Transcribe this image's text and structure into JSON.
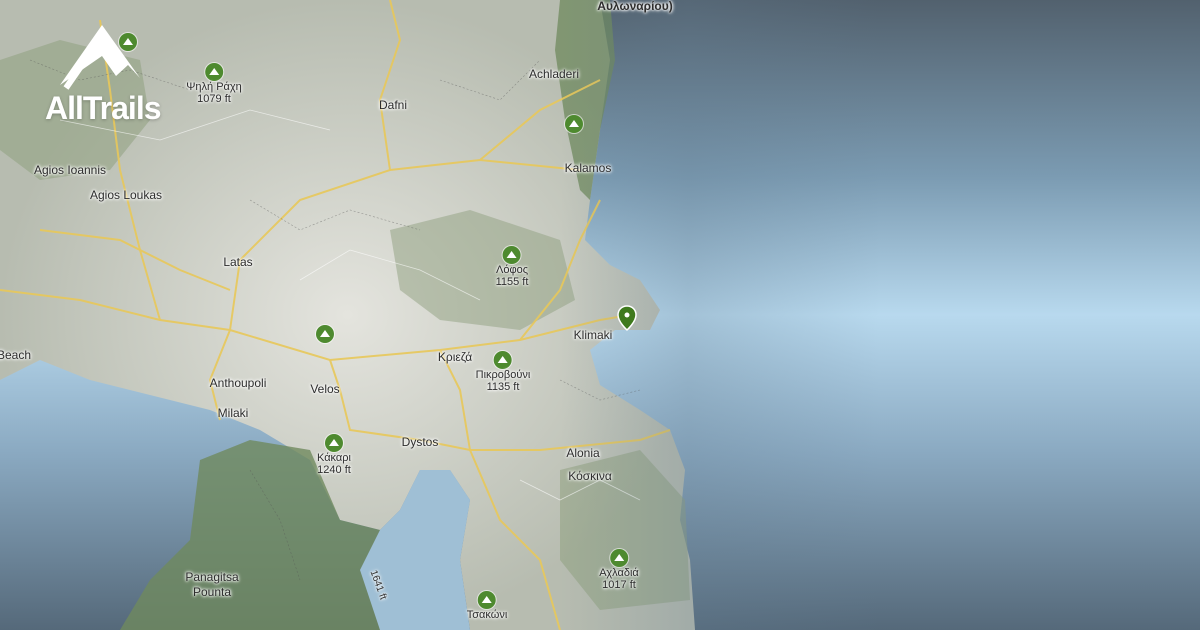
{
  "brand": {
    "name": "AllTrails",
    "logo_icon": "mountain-logo-icon"
  },
  "colors": {
    "sea": "#b8d9ee",
    "land": "#c9cbc4",
    "forest": "#6f8a5e",
    "road": "#e8c85a",
    "peak": "#4e8a2f",
    "pin": "#3f7a1e"
  },
  "places": [
    {
      "id": "achladeri",
      "name": "Achladeri"
    },
    {
      "id": "dafni",
      "name": "Dafni"
    },
    {
      "id": "kalamos",
      "name": "Kalamos"
    },
    {
      "id": "agios-ioannis",
      "name": "Agios Ioannis"
    },
    {
      "id": "agios-loukas",
      "name": "Agios Loukas"
    },
    {
      "id": "latas",
      "name": "Latas"
    },
    {
      "id": "beach",
      "name": "Beach"
    },
    {
      "id": "klimaki",
      "name": "Klimaki"
    },
    {
      "id": "krieza",
      "name": "Κριεζά"
    },
    {
      "id": "anthoupoli",
      "name": "Anthoupoli"
    },
    {
      "id": "velos",
      "name": "Velos"
    },
    {
      "id": "milaki",
      "name": "Milaki"
    },
    {
      "id": "dystos",
      "name": "Dystos"
    },
    {
      "id": "alonia",
      "name": "Alonia"
    },
    {
      "id": "koskina",
      "name": "Κόσκινα"
    },
    {
      "id": "panagitsa",
      "name": "Panagitsa"
    },
    {
      "id": "pounta",
      "name": "Pounta"
    },
    {
      "id": "top-cut",
      "name": "Αυλωναρίου)"
    }
  ],
  "peaks": [
    {
      "id": "psili-rachi",
      "name": "Ψηλή Ράχη",
      "elevation": "1079 ft"
    },
    {
      "id": "lofos",
      "name": "Λόφος",
      "elevation": "1155 ft"
    },
    {
      "id": "pikrovouni",
      "name": "Πικροβούνι",
      "elevation": "1135 ft"
    },
    {
      "id": "kakari",
      "name": "Κάκαρι",
      "elevation": "1240 ft"
    },
    {
      "id": "achladia",
      "name": "Αχλαδιά",
      "elevation": "1017 ft"
    },
    {
      "id": "tsakoni",
      "name": "Τσακώνι",
      "elevation": ""
    },
    {
      "id": "anon-1",
      "name": "",
      "elevation": ""
    },
    {
      "id": "anon-2",
      "name": "",
      "elevation": ""
    },
    {
      "id": "anon-3",
      "name": "",
      "elevation": ""
    }
  ],
  "misc_labels": {
    "contour_text": "1641 ft"
  }
}
